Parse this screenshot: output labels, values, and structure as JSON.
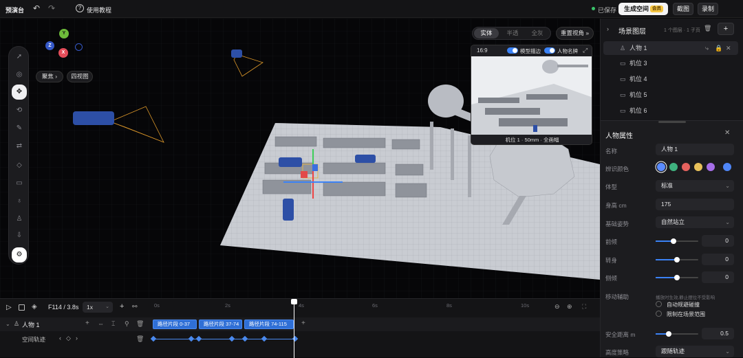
{
  "topbar": {
    "app_title": "预演台",
    "undo_icon": "undo-icon",
    "redo_icon": "redo-icon",
    "tutorial": "使用教程",
    "saved": "已保存",
    "generate": "生成空间",
    "member_badge": "会员",
    "screenshot": "截图",
    "record": "录制"
  },
  "viewport": {
    "focus_label": "聚焦",
    "four_view": "四视图",
    "gizmo_axes": {
      "y": "Y",
      "z": "Z",
      "x": "X"
    },
    "render_modes": [
      "实体",
      "半透",
      "全灰"
    ],
    "reset_view": "重置视角",
    "preview": {
      "ratio": "16:9",
      "model_outline": "模型描边",
      "character_nameplate": "人物名牌",
      "caption": "机位 1 · 50mm · 全画幅"
    }
  },
  "scene_layers": {
    "title": "场景图层",
    "counts": "1 个图层 · 1 子页",
    "items": [
      {
        "label": "人物 1",
        "icon": "person-icon"
      },
      {
        "label": "机位 3",
        "icon": "camera-icon"
      },
      {
        "label": "机位 4",
        "icon": "camera-icon"
      },
      {
        "label": "机位 5",
        "icon": "camera-icon"
      },
      {
        "label": "机位 6",
        "icon": "camera-icon"
      }
    ]
  },
  "properties": {
    "title": "人物属性",
    "name_label": "名称",
    "name_value": "人物 1",
    "color_label": "辨识颜色",
    "colors": [
      "#5b8cff",
      "#3fb27f",
      "#e5625e",
      "#e8c15a",
      "#a66ee8",
      "#4f86f7"
    ],
    "body_label": "体型",
    "body_value": "标准",
    "height_label": "身高 cm",
    "height_value": "175",
    "pose_label": "基础姿势",
    "pose_value": "自然站立",
    "lean_label": "前倾",
    "lean_value": "0",
    "lean_level": 0.42,
    "turn_label": "转身",
    "turn_value": "0",
    "turn_level": 0.5,
    "tilt_label": "侧倾",
    "tilt_value": "0",
    "tilt_level": 0.5,
    "move_assist_label": "移动辅助",
    "move_assist_hint": "播放时生效,静止摆位不受影响",
    "auto_avoid": "自动规避碰撞",
    "limit_scene": "限制在场景范围",
    "safe_distance_label": "安全距离 m",
    "safe_distance_value": "0.5",
    "safe_distance_level": 0.3,
    "height_strategy_label": "高度策略",
    "height_strategy_value": "跟随轨迹"
  },
  "timeline": {
    "frame": "F114 / 3.8s",
    "speed": "1x",
    "ruler": [
      "0s",
      "2s",
      "4s",
      "6s",
      "8s",
      "10s"
    ],
    "track_name": "人物 1",
    "sub_track": "空间轨迹",
    "clips": [
      "路径片段 0-37",
      "路径片段 37-74",
      "路径片段 74-115"
    ]
  }
}
